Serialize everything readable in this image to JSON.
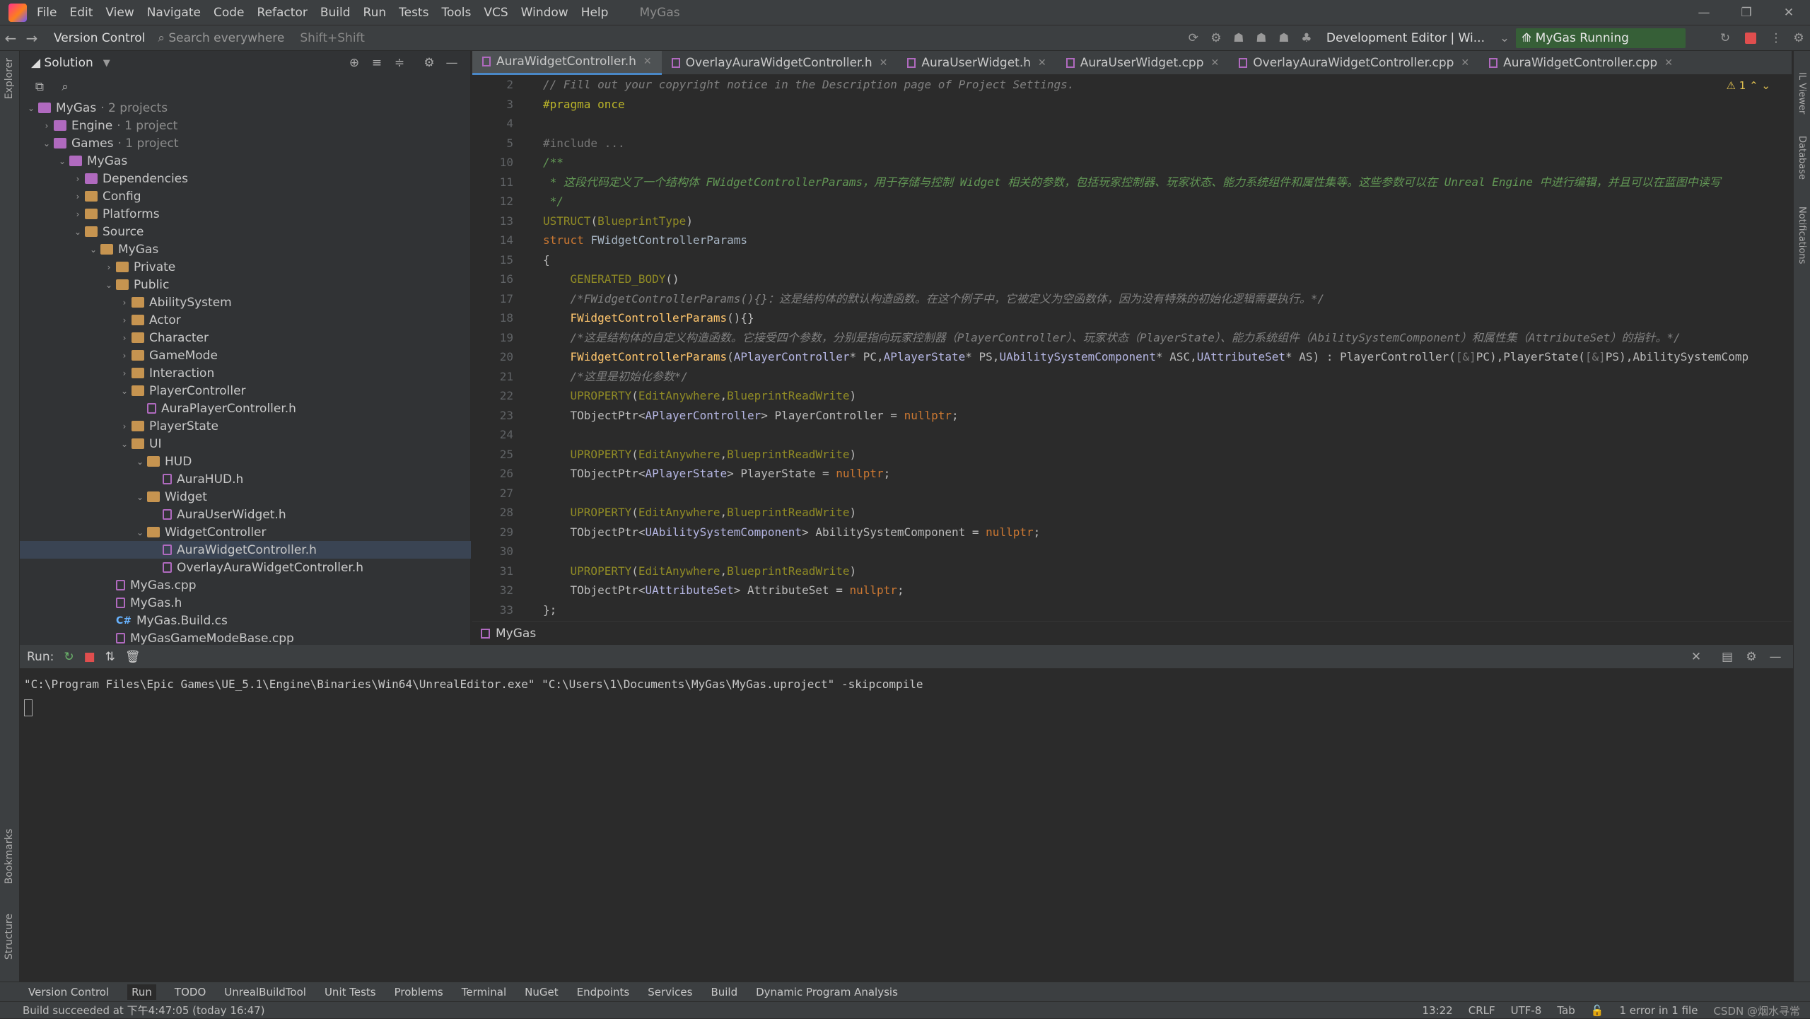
{
  "menubar": {
    "items": [
      "File",
      "Edit",
      "View",
      "Navigate",
      "Code",
      "Refactor",
      "Build",
      "Run",
      "Tests",
      "Tools",
      "VCS",
      "Window",
      "Help"
    ],
    "app_title": "MyGas"
  },
  "toolbar": {
    "version_control": "Version Control",
    "search_placeholder": "Search everywhere",
    "search_shortcut": "Shift+Shift",
    "config": "Development Editor | Wi...",
    "running": "MyGas Running",
    "running_color": "#365f37"
  },
  "stripes": {
    "explorer": "Explorer",
    "bookmarks": "Bookmarks",
    "structure": "Structure",
    "viewer": "IL Viewer",
    "database": "Database",
    "notifications": "Notifications"
  },
  "explorer": {
    "title": "Solution",
    "tree": [
      {
        "label": "MyGas",
        "extra": "· 2 projects",
        "depth": 0,
        "kind": "proj",
        "open": true
      },
      {
        "label": "Engine",
        "extra": "· 1 project",
        "depth": 1,
        "kind": "proj",
        "open": false
      },
      {
        "label": "Games",
        "extra": "· 1 project",
        "depth": 1,
        "kind": "proj",
        "open": true
      },
      {
        "label": "MyGas",
        "extra": "",
        "depth": 2,
        "kind": "proj",
        "open": true
      },
      {
        "label": "Dependencies",
        "extra": "",
        "depth": 3,
        "kind": "dep",
        "open": false
      },
      {
        "label": "Config",
        "extra": "",
        "depth": 3,
        "kind": "fold",
        "open": false
      },
      {
        "label": "Platforms",
        "extra": "",
        "depth": 3,
        "kind": "fold",
        "open": false
      },
      {
        "label": "Source",
        "extra": "",
        "depth": 3,
        "kind": "fold",
        "open": true
      },
      {
        "label": "MyGas",
        "extra": "",
        "depth": 4,
        "kind": "fold",
        "open": true
      },
      {
        "label": "Private",
        "extra": "",
        "depth": 5,
        "kind": "fold",
        "open": false
      },
      {
        "label": "Public",
        "extra": "",
        "depth": 5,
        "kind": "fold",
        "open": true
      },
      {
        "label": "AbilitySystem",
        "extra": "",
        "depth": 6,
        "kind": "fold",
        "open": false
      },
      {
        "label": "Actor",
        "extra": "",
        "depth": 6,
        "kind": "fold",
        "open": false
      },
      {
        "label": "Character",
        "extra": "",
        "depth": 6,
        "kind": "fold",
        "open": false
      },
      {
        "label": "GameMode",
        "extra": "",
        "depth": 6,
        "kind": "fold",
        "open": false
      },
      {
        "label": "Interaction",
        "extra": "",
        "depth": 6,
        "kind": "fold",
        "open": false
      },
      {
        "label": "PlayerController",
        "extra": "",
        "depth": 6,
        "kind": "fold",
        "open": true
      },
      {
        "label": "AuraPlayerController.h",
        "extra": "",
        "depth": 7,
        "kind": "file",
        "open": null
      },
      {
        "label": "PlayerState",
        "extra": "",
        "depth": 6,
        "kind": "fold",
        "open": false
      },
      {
        "label": "UI",
        "extra": "",
        "depth": 6,
        "kind": "fold",
        "open": true
      },
      {
        "label": "HUD",
        "extra": "",
        "depth": 7,
        "kind": "fold",
        "open": true
      },
      {
        "label": "AuraHUD.h",
        "extra": "",
        "depth": 8,
        "kind": "file",
        "open": null
      },
      {
        "label": "Widget",
        "extra": "",
        "depth": 7,
        "kind": "fold",
        "open": true
      },
      {
        "label": "AuraUserWidget.h",
        "extra": "",
        "depth": 8,
        "kind": "file",
        "open": null
      },
      {
        "label": "WidgetController",
        "extra": "",
        "depth": 7,
        "kind": "fold",
        "open": true
      },
      {
        "label": "AuraWidgetController.h",
        "extra": "",
        "depth": 8,
        "kind": "file",
        "open": null,
        "selected": true
      },
      {
        "label": "OverlayAuraWidgetController.h",
        "extra": "",
        "depth": 8,
        "kind": "file",
        "open": null
      },
      {
        "label": "MyGas.cpp",
        "extra": "",
        "depth": 5,
        "kind": "file",
        "open": null
      },
      {
        "label": "MyGas.h",
        "extra": "",
        "depth": 5,
        "kind": "file",
        "open": null
      },
      {
        "label": "MyGas.Build.cs",
        "extra": "",
        "depth": 5,
        "kind": "cs",
        "open": null
      },
      {
        "label": "MyGasGameModeBase.cpp",
        "extra": "",
        "depth": 5,
        "kind": "file",
        "open": null
      }
    ]
  },
  "tabs": [
    {
      "label": "AuraWidgetController.h",
      "active": true
    },
    {
      "label": "OverlayAuraWidgetController.h",
      "active": false
    },
    {
      "label": "AuraUserWidget.h",
      "active": false
    },
    {
      "label": "AuraUserWidget.cpp",
      "active": false
    },
    {
      "label": "OverlayAuraWidgetController.cpp",
      "active": false
    },
    {
      "label": "AuraWidgetController.cpp",
      "active": false
    }
  ],
  "editor": {
    "warnings": "1",
    "lines": [
      {
        "n": "2",
        "html": "<span class='cm'>// Fill out your copyright notice in the Description page of Project Settings.</span>"
      },
      {
        "n": "3",
        "html": "<span class='pp'>#pragma once</span>"
      },
      {
        "n": "4",
        "html": ""
      },
      {
        "n": "5",
        "html": "<span class='grey'>#include ...</span>"
      },
      {
        "n": "10",
        "html": "<span class='cmz'>/**</span>"
      },
      {
        "n": "11",
        "html": "<span class='cmz'> * 这段代码定义了一个结构体 FWidgetControllerParams，用于存储与控制 Widget 相关的参数，包括玩家控制器、玩家状态、能力系统组件和属性集等。这些参数可以在 Unreal Engine 中进行编辑，并且可以在蓝图中读写</span>"
      },
      {
        "n": "12",
        "html": "<span class='cmz'> */</span>"
      },
      {
        "n": "13",
        "html": "<span class='mac'>USTRUCT</span>(<span class='mac'>BlueprintType</span>)"
      },
      {
        "n": "14",
        "html": "<span class='kw'>struct</span> <span class='nm'>FWidgetControllerParams</span>"
      },
      {
        "n": "15",
        "html": "{"
      },
      {
        "n": "16",
        "html": "    <span class='mac'>GENERATED_BODY</span>()"
      },
      {
        "n": "17",
        "html": "    <span class='cm'>/*FWidgetControllerParams(){}：这是结构体的默认构造函数。在这个例子中，它被定义为空函数体，因为没有特殊的初始化逻辑需要执行。*/</span>"
      },
      {
        "n": "18",
        "html": "    <span class='fn'>FWidgetControllerParams</span>(){}"
      },
      {
        "n": "19",
        "html": "    <span class='cm'>/*这是结构体的自定义构造函数。它接受四个参数，分别是指向玩家控制器（PlayerController）、玩家状态（PlayerState）、能力系统组件（AbilitySystemComponent）和属性集（AttributeSet）的指针。*/</span>"
      },
      {
        "n": "20",
        "html": "    <span class='fn'>FWidgetControllerParams</span>(<span class='ty'>APlayerController</span>* PC,<span class='ty'>APlayerState</span>* PS,<span class='ty'>UAbilitySystemComponent</span>* ASC,<span class='ty'>UAttributeSet</span>* AS) : PlayerController(<span class='grey'>[&]</span>PC),PlayerState(<span class='grey'>[&]</span>PS),AbilitySystemComp"
      },
      {
        "n": "21",
        "html": "    <span class='cm'>/*这里是初始化参数*/</span>"
      },
      {
        "n": "22",
        "html": "    <span class='mac'>UPROPERTY</span>(<span class='mac'>EditAnywhere</span>,<span class='mac'>BlueprintReadWrite</span>)"
      },
      {
        "n": "23",
        "html": "    TObjectPtr&lt;<span class='ty'>APlayerController</span>&gt; PlayerController = <span class='nu'>nullptr</span>;"
      },
      {
        "n": "24",
        "html": ""
      },
      {
        "n": "25",
        "html": "    <span class='mac'>UPROPERTY</span>(<span class='mac'>EditAnywhere</span>,<span class='mac'>BlueprintReadWrite</span>)"
      },
      {
        "n": "26",
        "html": "    TObjectPtr&lt;<span class='ty'>APlayerState</span>&gt; PlayerState = <span class='nu'>nullptr</span>;"
      },
      {
        "n": "27",
        "html": ""
      },
      {
        "n": "28",
        "html": "    <span class='mac'>UPROPERTY</span>(<span class='mac'>EditAnywhere</span>,<span class='mac'>BlueprintReadWrite</span>)"
      },
      {
        "n": "29",
        "html": "    TObjectPtr&lt;<span class='ty'>UAbilitySystemComponent</span>&gt; AbilitySystemComponent = <span class='nu'>nullptr</span>;"
      },
      {
        "n": "30",
        "html": ""
      },
      {
        "n": "31",
        "html": "    <span class='mac'>UPROPERTY</span>(<span class='mac'>EditAnywhere</span>,<span class='mac'>BlueprintReadWrite</span>)"
      },
      {
        "n": "32",
        "html": "    TObjectPtr&lt;<span class='ty'>UAttributeSet</span>&gt; AttributeSet = <span class='nu'>nullptr</span>;"
      },
      {
        "n": "33",
        "html": "};"
      }
    ]
  },
  "breadcrumb": "MyGas",
  "run": {
    "label": "Run:",
    "command": "\"C:\\Program Files\\Epic Games\\UE_5.1\\Engine\\Binaries\\Win64\\UnrealEditor.exe\" \"C:\\Users\\1\\Documents\\MyGas\\MyGas.uproject\" -skipcompile"
  },
  "bottombar": [
    "Version Control",
    "Run",
    "TODO",
    "UnrealBuildTool",
    "Unit Tests",
    "Problems",
    "Terminal",
    "NuGet",
    "Endpoints",
    "Services",
    "Build",
    "Dynamic Program Analysis"
  ],
  "status": {
    "left": "Build succeeded at 下午4:47:05 (today 16:47)",
    "position": "13:22",
    "line_sep": "CRLF",
    "encoding": "UTF-8",
    "indent": "Tab",
    "errors": "1 error in 1 file",
    "watermark": "CSDN @烟水寻常"
  }
}
